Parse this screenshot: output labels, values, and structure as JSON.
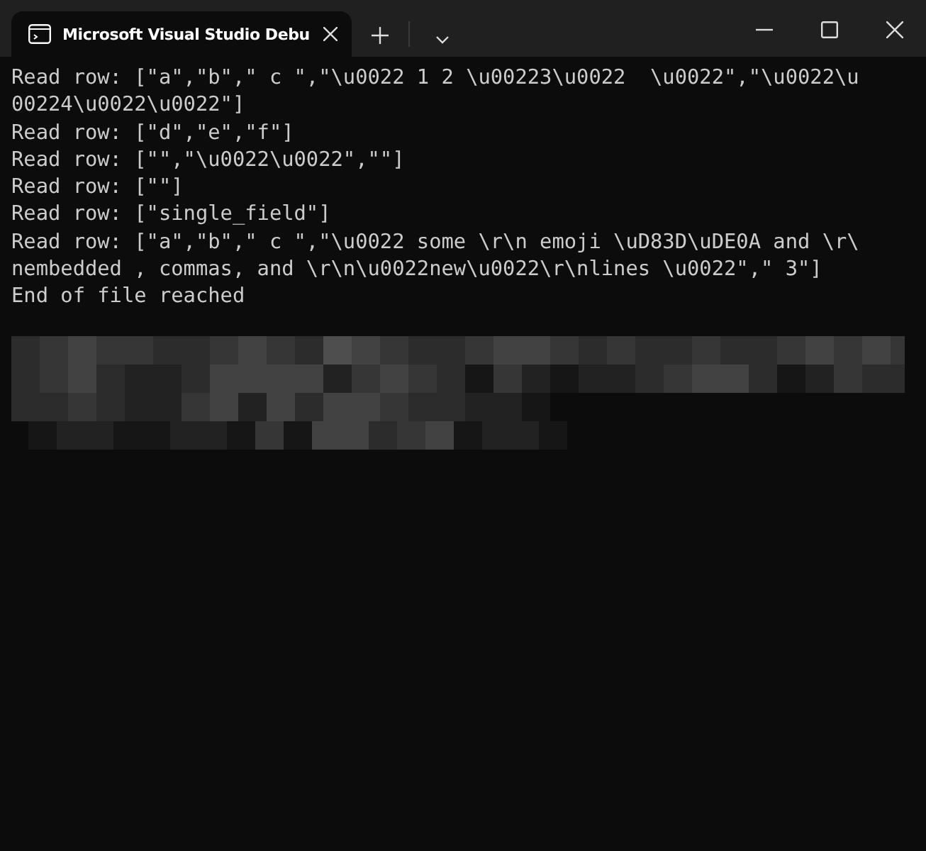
{
  "window": {
    "tabs": [
      {
        "title": "Microsoft Visual Studio Debu",
        "selected": true
      }
    ]
  },
  "console": {
    "lines": [
      "Read row: [\"a\",\"b\",\" c \",\"\\u0022 1 2 \\u00223\\u0022  \\u0022\",\"\\u0022\\u",
      "00224\\u0022\\u0022\"]",
      "Read row: [\"d\",\"e\",\"f\"]",
      "Read row: [\"\",\"\\u0022\\u0022\",\"\"]",
      "Read row: [\"\"]",
      "Read row: [\"single_field\"]",
      "Read row: [\"a\",\"b\",\" c \",\"\\u0022 some \\r\\n emoji \\uD83D\\uDE0A and \\r\\",
      "nembedded , commas, and \\r\\n\\u0022new\\u0022\\r\\nlines \\u0022\",\" 3\"]",
      "End of file reached"
    ]
  }
}
